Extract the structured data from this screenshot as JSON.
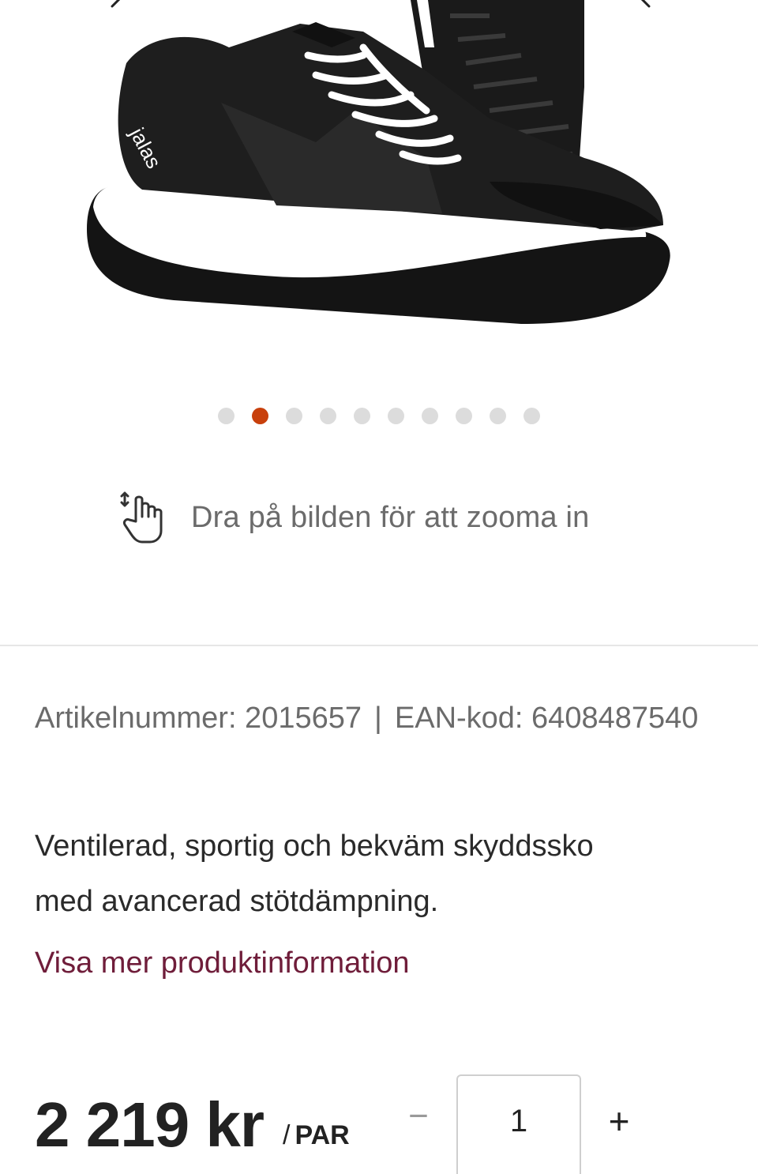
{
  "gallery": {
    "prev_icon": "chevron-left-icon",
    "next_icon": "chevron-right-icon",
    "image_alt": "Skyddssko",
    "logo_text": "jalas",
    "dots_total": 10,
    "active_dot": 2
  },
  "zoom_hint": {
    "icon": "touch-drag-hand-icon",
    "text": "Dra på bilden för att zooma in"
  },
  "article": {
    "number_label": "Artikelnummer: 2015657",
    "separator": "|",
    "ean_label": "EAN-kod: 6408487540"
  },
  "description": {
    "line1": "Ventilerad, sportig och bekväm skyddssko",
    "line2": "med avancerad stötdämpning."
  },
  "more_link": "Visa mer produktinformation",
  "price": {
    "amount": "2 219 kr",
    "slash": "/",
    "unit": "PAR"
  },
  "quantity": {
    "minus_label": "−",
    "value": "1",
    "plus_label": "+"
  },
  "colors": {
    "active_dot": "#c8400c",
    "inactive_dot": "#dcdcdc",
    "link": "#6f1d3a",
    "muted_text": "#6b6b6b"
  }
}
